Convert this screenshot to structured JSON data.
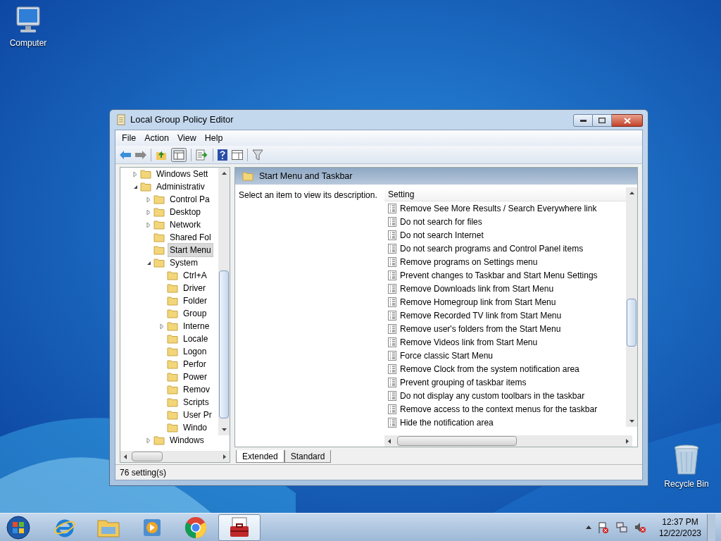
{
  "desktop_icons": [
    {
      "kind": "computer",
      "label": "Computer"
    },
    {
      "kind": "bin",
      "label": "Recycle Bin"
    }
  ],
  "window": {
    "title": "Local Group Policy Editor",
    "menu": [
      "File",
      "Action",
      "View",
      "Help"
    ],
    "tree": [
      {
        "label": "Windows Sett",
        "expanded": false,
        "selected": false
      },
      {
        "label": "Administrativ",
        "expanded": true,
        "selected": false,
        "children": [
          {
            "label": "Control Pa",
            "expanded": false,
            "selected": false
          },
          {
            "label": "Desktop",
            "expanded": false,
            "selected": false
          },
          {
            "label": "Network",
            "expanded": false,
            "selected": false
          },
          {
            "label": "Shared Fol",
            "selected": false
          },
          {
            "label": "Start Menu",
            "selected": true
          },
          {
            "label": "System",
            "expanded": true,
            "selected": false,
            "children": [
              {
                "label": "Ctrl+A",
                "selected": false
              },
              {
                "label": "Driver",
                "selected": false
              },
              {
                "label": "Folder",
                "selected": false
              },
              {
                "label": "Group",
                "selected": false
              },
              {
                "label": "Interne",
                "expanded": false,
                "selected": false
              },
              {
                "label": "Locale",
                "selected": false
              },
              {
                "label": "Logon",
                "selected": false
              },
              {
                "label": "Perfor",
                "selected": false
              },
              {
                "label": "Power",
                "selected": false
              },
              {
                "label": "Remov",
                "selected": false
              },
              {
                "label": "Scripts",
                "selected": false
              },
              {
                "label": "User Pr",
                "selected": false
              },
              {
                "label": "Windo",
                "selected": false
              }
            ]
          },
          {
            "label": "Windows",
            "expanded": false,
            "selected": false
          }
        ]
      }
    ],
    "pane_title": "Start Menu and Taskbar",
    "description": "Select an item to view its description.",
    "column": "Setting",
    "settings": [
      "Remove See More Results / Search Everywhere link",
      "Do not search for files",
      "Do not search Internet",
      "Do not search programs and Control Panel items",
      "Remove programs on Settings menu",
      "Prevent changes to Taskbar and Start Menu Settings",
      "Remove Downloads link from Start Menu",
      "Remove Homegroup link from Start Menu",
      "Remove Recorded TV link from Start Menu",
      "Remove user's folders from the Start Menu",
      "Remove Videos link from Start Menu",
      "Force classic Start Menu",
      "Remove Clock from the system notification area",
      "Prevent grouping of taskbar items",
      "Do not display any custom toolbars in the taskbar",
      "Remove access to the context menus for the taskbar",
      "Hide the notification area"
    ],
    "tabs": [
      {
        "label": "Extended",
        "selected": true
      },
      {
        "label": "Standard",
        "selected": false
      }
    ],
    "status": "76 setting(s)"
  },
  "taskbar": {
    "apps": [
      {
        "kind": "ie",
        "selected": false
      },
      {
        "kind": "explorer",
        "selected": false
      },
      {
        "kind": "media",
        "selected": false
      },
      {
        "kind": "chrome",
        "selected": false
      },
      {
        "kind": "toolbox",
        "selected": true
      }
    ],
    "time": "12:37 PM",
    "date": "12/22/2023"
  }
}
